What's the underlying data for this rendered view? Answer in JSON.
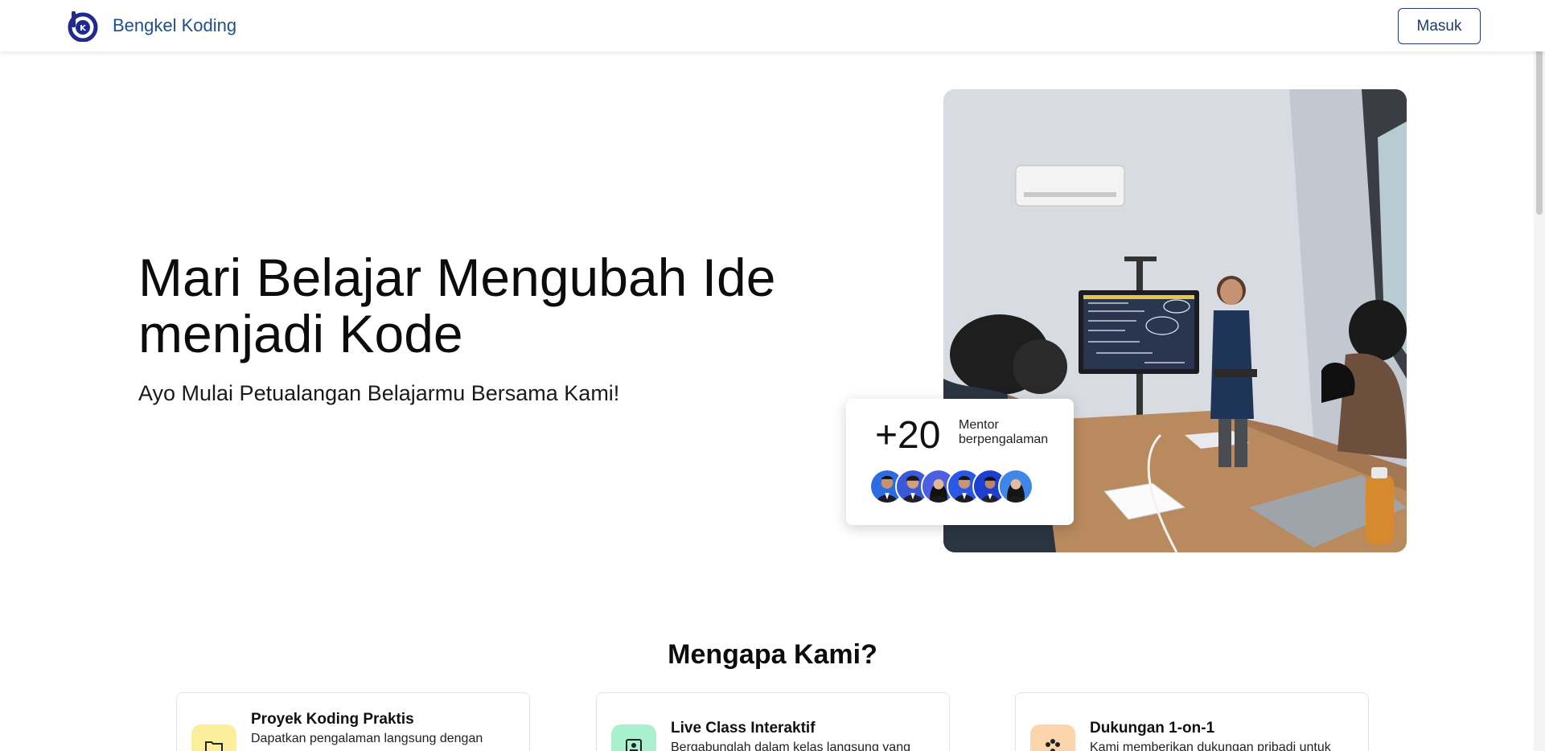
{
  "navbar": {
    "brand_name": "Bengkel Koding",
    "login_label": "Masuk"
  },
  "hero": {
    "title_line1": "Mari Belajar Mengubah Ide",
    "title_line2": "menjadi Kode",
    "subtitle": "Ayo Mulai Petualangan Belajarmu Bersama Kami!",
    "photo_icon": "classroom-photo",
    "mentor_count": "+20",
    "mentor_label_line1": "Mentor",
    "mentor_label_line2": "berpengalaman",
    "mentor_avatar_count": 6
  },
  "why": {
    "title": "Mengapa Kami?",
    "features": [
      {
        "title": "Proyek Koding Praktis",
        "desc": "Dapatkan pengalaman langsung dengan",
        "icon": "folder-icon",
        "color": "#fcef9c"
      },
      {
        "title": "Live Class Interaktif",
        "desc": "Bergabunglah dalam kelas langsung yang",
        "icon": "presentation-icon",
        "color": "#a9f0cf"
      },
      {
        "title": "Dukungan 1-on-1",
        "desc": "Kami memberikan dukungan pribadi untuk",
        "icon": "people-icon",
        "color": "#fdd5ad"
      }
    ]
  },
  "colors": {
    "brand": "#1f4e8c",
    "login_border": "#1f3a6b"
  }
}
